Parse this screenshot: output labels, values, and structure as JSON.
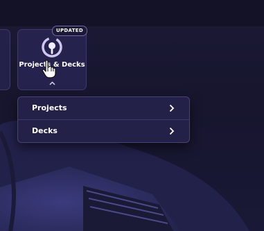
{
  "colors": {
    "background": "#17152d",
    "tile": "#25224d",
    "tile_border": "#3e3a6b",
    "dropdown": "#242149",
    "text": "#ffffff"
  },
  "left_tile": {
    "label_fragment": "s"
  },
  "tile": {
    "label": "Projects & Decks",
    "badge": "UPDATED",
    "icon": "projects-decks-icon",
    "expanded": true
  },
  "dropdown": {
    "items": [
      {
        "label": "Projects",
        "icon": "chevron-right-icon"
      },
      {
        "label": "Decks",
        "icon": "chevron-right-icon"
      }
    ]
  }
}
